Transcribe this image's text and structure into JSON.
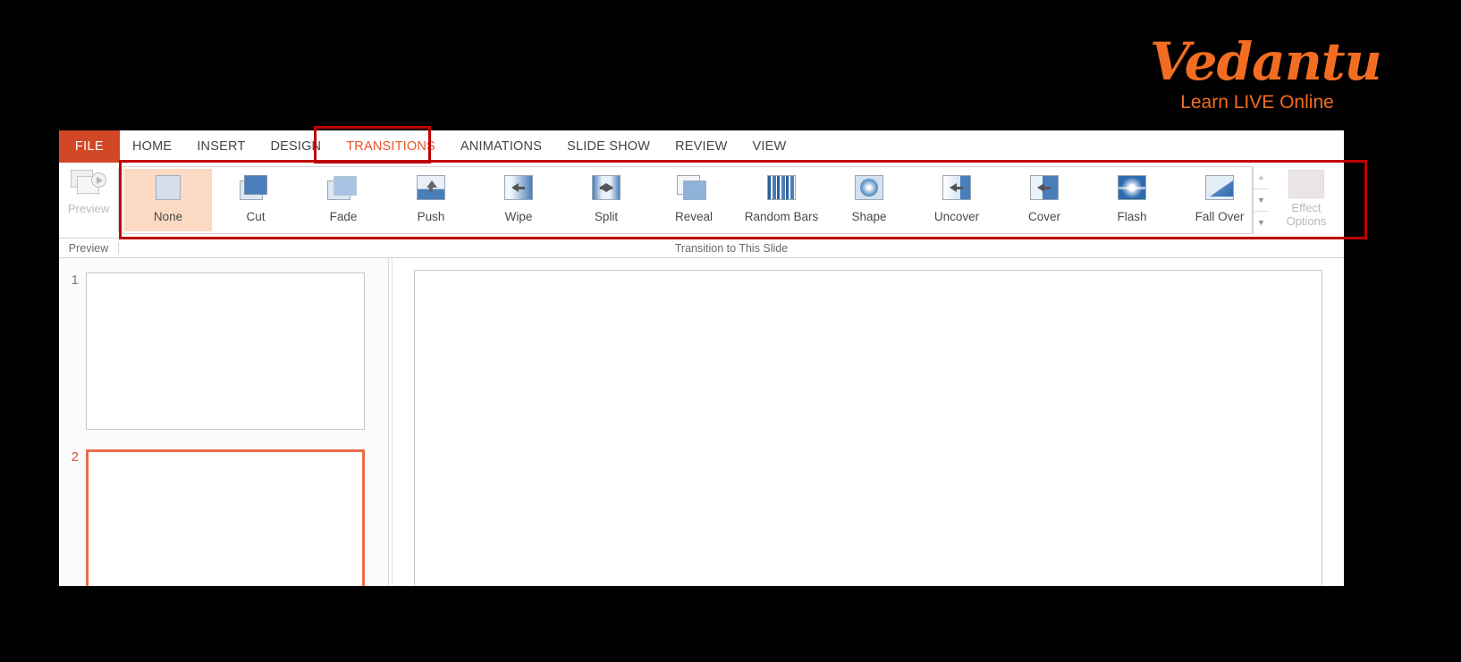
{
  "brand": {
    "logo_text": "Vedantu",
    "tagline": "Learn LIVE Online",
    "color": "#F26D21"
  },
  "ribbon": {
    "file_tab": "FILE",
    "tabs": [
      {
        "label": "HOME",
        "active": false
      },
      {
        "label": "INSERT",
        "active": false
      },
      {
        "label": "DESIGN",
        "active": false
      },
      {
        "label": "TRANSITIONS",
        "active": true
      },
      {
        "label": "ANIMATIONS",
        "active": false
      },
      {
        "label": "SLIDE SHOW",
        "active": false
      },
      {
        "label": "REVIEW",
        "active": false
      },
      {
        "label": "VIEW",
        "active": false
      }
    ],
    "groups": {
      "preview": {
        "button_label": "Preview",
        "caption": "Preview",
        "icon": "preview-play-icon",
        "enabled": false
      },
      "transition_to_this_slide": {
        "caption": "Transition to This Slide",
        "selected": "None",
        "items": [
          {
            "label": "None",
            "icon": "transition-none-icon"
          },
          {
            "label": "Cut",
            "icon": "transition-cut-icon"
          },
          {
            "label": "Fade",
            "icon": "transition-fade-icon"
          },
          {
            "label": "Push",
            "icon": "transition-push-icon"
          },
          {
            "label": "Wipe",
            "icon": "transition-wipe-icon"
          },
          {
            "label": "Split",
            "icon": "transition-split-icon"
          },
          {
            "label": "Reveal",
            "icon": "transition-reveal-icon"
          },
          {
            "label": "Random Bars",
            "icon": "transition-random-bars-icon"
          },
          {
            "label": "Shape",
            "icon": "transition-shape-icon"
          },
          {
            "label": "Uncover",
            "icon": "transition-uncover-icon"
          },
          {
            "label": "Cover",
            "icon": "transition-cover-icon"
          },
          {
            "label": "Flash",
            "icon": "transition-flash-icon"
          },
          {
            "label": "Fall Over",
            "icon": "transition-fall-over-icon"
          }
        ],
        "scroll": {
          "up": "▲",
          "down": "▼",
          "more": "▼"
        }
      },
      "effect_options": {
        "label_line1": "Effect",
        "label_line2": "Options",
        "dropdown_glyph": "▾",
        "enabled": false
      }
    }
  },
  "workspace": {
    "slides": [
      {
        "number": "1",
        "selected": false
      },
      {
        "number": "2",
        "selected": true
      }
    ],
    "selection_color": "#EE6C4D"
  },
  "annotations": {
    "color": "#C00000",
    "boxes": [
      "transitions-tab",
      "transition-gallery-group"
    ]
  }
}
